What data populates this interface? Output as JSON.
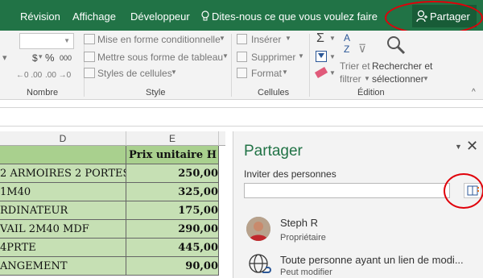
{
  "menubar": {
    "items": [
      "Révision",
      "Affichage",
      "Développeur"
    ],
    "tell_me": "Dites-nous ce que vous voulez faire",
    "share_label": "Partager"
  },
  "ribbon": {
    "number_group": {
      "label": "Nombre",
      "currency": "$",
      "percent": "%",
      "thousands": "000"
    },
    "style_group": {
      "label": "Style",
      "items": [
        "Mise en forme conditionnelle",
        "Mettre sous forme de tableau",
        "Styles de cellules"
      ]
    },
    "cells_group": {
      "label": "Cellules",
      "items": [
        "Insérer",
        "Supprimer",
        "Format"
      ]
    },
    "editing_group": {
      "label": "Édition",
      "sort_filter": [
        "Trier et",
        "filtrer"
      ],
      "find_select": [
        "Rechercher et",
        "sélectionner"
      ]
    }
  },
  "sheet": {
    "columns": [
      "D",
      "E"
    ],
    "header_row": {
      "d": "",
      "e": "Prix unitaire H"
    },
    "rows": [
      {
        "d": "2 ARMOIRES 2 PORTES",
        "e": "250,00"
      },
      {
        "d": "1M40",
        "e": "325,00"
      },
      {
        "d": "RDINATEUR",
        "e": "175,00"
      },
      {
        "d": "VAIL 2M40 MDF",
        "e": "290,00"
      },
      {
        "d": "4PRTE",
        "e": "445,00"
      },
      {
        "d": "ANGEMENT",
        "e": "90,00"
      }
    ]
  },
  "share_pane": {
    "title": "Partager",
    "invite_label": "Inviter des personnes",
    "invite_value": "",
    "people": [
      {
        "name": "Steph R",
        "role": "Propriétaire"
      },
      {
        "name": "Toute personne ayant un lien de modi...",
        "role": "Peut modifier"
      }
    ]
  },
  "colors": {
    "excel_green": "#217346",
    "cell_fill": "#c6e0b4",
    "highlight": "#e0000a"
  }
}
